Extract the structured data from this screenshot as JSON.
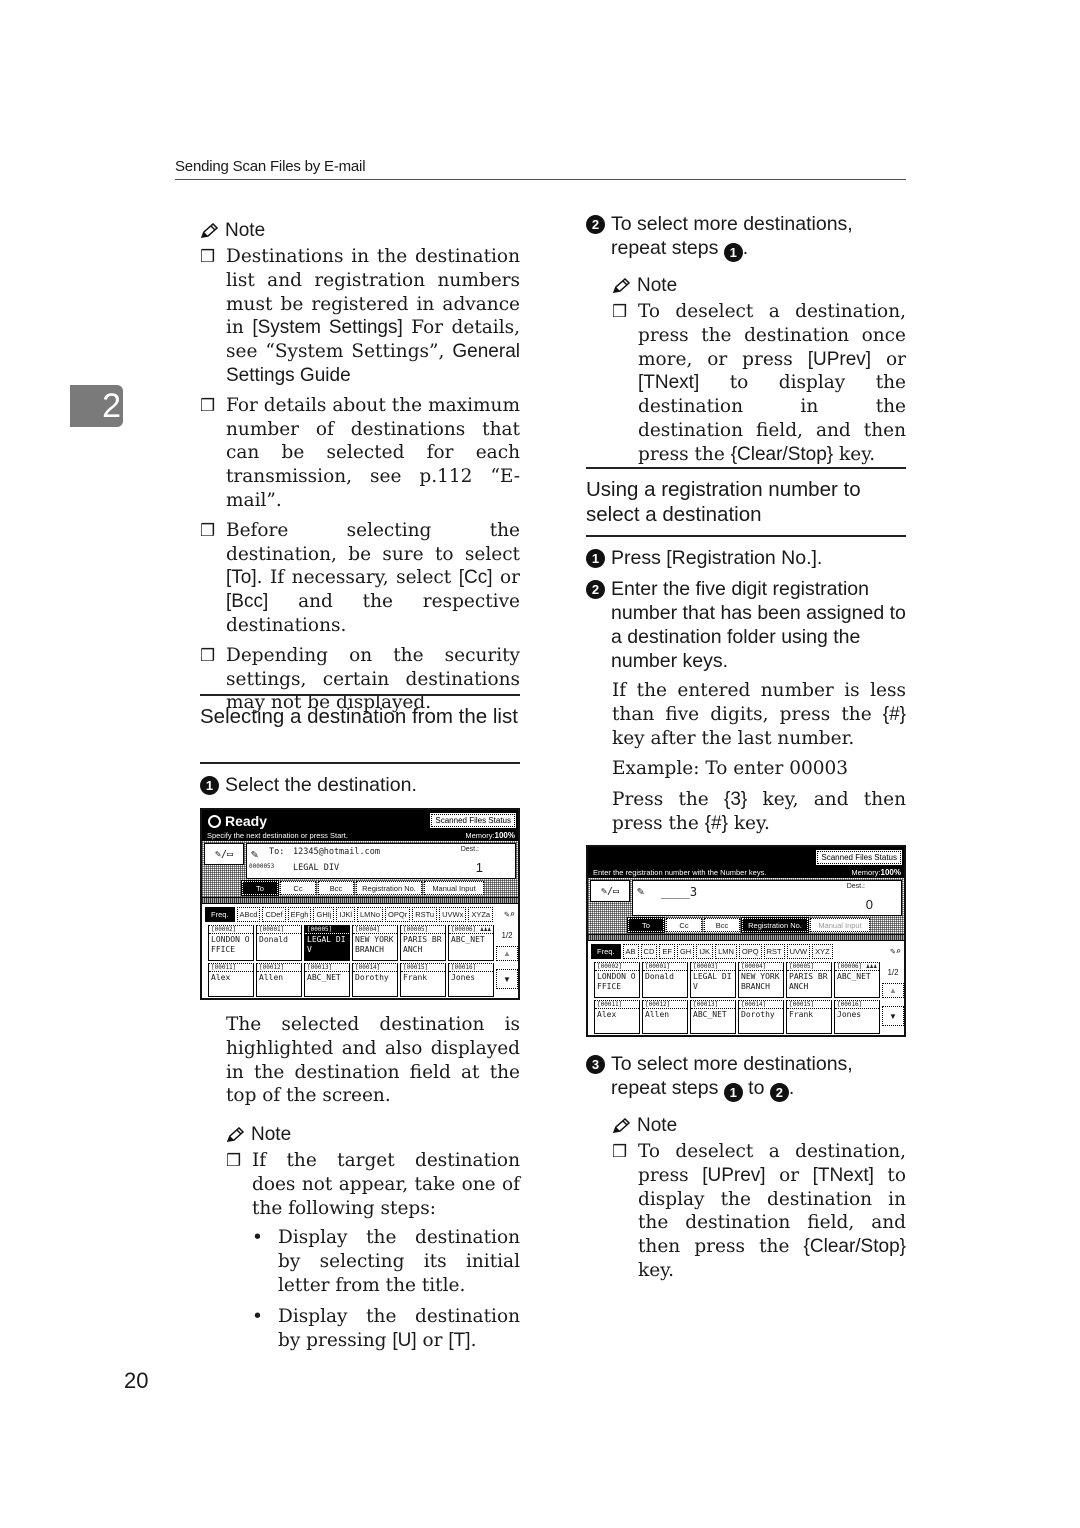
{
  "header": {
    "running_title": "Sending Scan Files by E-mail"
  },
  "chapter_tab": "2",
  "page_number": "20",
  "left_column": {
    "note1": {
      "heading": "Note",
      "items": [
        {
          "pre": "Destinations in the destination list and registration numbers must be registered in advance in ",
          "key": "[System Settings]",
          "post": " For details, see “System Settings”, ",
          "ref": "General Settings Guide"
        },
        {
          "text": "For details about the maximum number of destinations that can be selected for each transmission, see p.112 “E-mail”."
        },
        {
          "pre": "Before selecting the destination, be sure to select ",
          "key1": "[To]",
          "mid": ". If necessary, select ",
          "key2": "[Cc]",
          "mid2": " or ",
          "key3": "[Bcc]",
          "post": " and the respective destinations."
        },
        {
          "text": "Depending on the security settings, certain destinations may not be displayed."
        }
      ]
    },
    "section_title": "Selecting a destination from the list",
    "step1": {
      "num": "1",
      "text": "Select the destination."
    },
    "after_screen_text": "The selected destination is highlighted and also displayed in the destination field at the top of the screen.",
    "note2": {
      "heading": "Note",
      "item": "If the target destination does not appear, take one of the following steps:",
      "bullets": [
        {
          "text": "Display the destination by selecting its initial letter from the title."
        },
        {
          "pre": "Display the destination by pressing ",
          "key1": "[U]",
          "mid": " or ",
          "key2": "[T]",
          "post": "."
        }
      ]
    }
  },
  "right_column": {
    "step2": {
      "num": "2",
      "text": "To select more destinations, repeat steps",
      "ref": "1",
      "post": "."
    },
    "note3": {
      "heading": "Note",
      "item": {
        "pre": "To deselect a destination, press the destination once more, or press ",
        "key1": "[UPrev]",
        "mid": " or ",
        "key2": "[TNext]",
        "mid2": " to display the destination in the destination field, and then press the ",
        "key3": "{Clear/Stop}",
        "post": " key."
      }
    },
    "section_title": "Using a registration number to select a destination",
    "steps": [
      {
        "num": "1",
        "pre": "Press ",
        "key": "[Registration No.]",
        "post": "."
      },
      {
        "num": "2",
        "text": "Enter the five digit registration number that has been assigned to a destination folder using the number keys."
      }
    ],
    "para1": {
      "pre": "If the entered number is less than five digits, press the ",
      "key": "{#}",
      "post": " key after the last number."
    },
    "para2": "Example: To enter 00003",
    "para3": {
      "pre": "Press the ",
      "key1": "{3}",
      "mid": " key, and then press the ",
      "key2": "{#}",
      "post": " key."
    },
    "step3": {
      "num": "3",
      "text": "To select more destinations, repeat steps",
      "ref1": "1",
      "mid": "to",
      "ref2": "2",
      "post": "."
    },
    "note4": {
      "heading": "Note",
      "item": {
        "pre": "To deselect a destination, press ",
        "key1": "[UPrev]",
        "mid": " or ",
        "key2": "[TNext]",
        "mid2": " to display the destination in the destination field, and then press the ",
        "key3": "{Clear/Stop}",
        "post": " key."
      }
    }
  },
  "screen1": {
    "status": "Ready",
    "scanned_files_status": "Scanned Files Status",
    "message": "Specify the next destination or press Start.",
    "memory_label": "Memory:",
    "memory_value": "100%",
    "to_label": "To:",
    "to_value": "12345@hotmail.com",
    "reg_code": "0000053",
    "dest_name": "LEGAL DIV",
    "dest_label": "Dest.:",
    "dest_count": "1",
    "tabs": [
      "To",
      "Cc",
      "Bcc",
      "Registration No.",
      "Manual Input"
    ],
    "letters": [
      "Freq.",
      "ABcd",
      "CDef",
      "EFgh",
      "GHIj",
      "IJKl",
      "LMNo",
      "OPQr",
      "RSTu",
      "UVWx",
      "XYZa"
    ],
    "page": "1/2",
    "cells": [
      {
        "code": "[00002]",
        "name": "LONDON O FFICE"
      },
      {
        "code": "[00001]",
        "name": "Donald"
      },
      {
        "code": "[00005]",
        "name": "LEGAL DI V",
        "selected": true
      },
      {
        "code": "[00004]",
        "name": "NEW YORK BRANCH"
      },
      {
        "code": "[00005]",
        "name": "PARIS BR ANCH"
      },
      {
        "code": "[00006]",
        "name": "ABC_NET",
        "group": true
      },
      {
        "code": "[00011]",
        "name": "Alex"
      },
      {
        "code": "[00012]",
        "name": "Allen"
      },
      {
        "code": "[00013]",
        "name": "ABC_NET"
      },
      {
        "code": "[00014]",
        "name": "Dorothy"
      },
      {
        "code": "[00015]",
        "name": "Frank"
      },
      {
        "code": "[00016]",
        "name": "Jones"
      }
    ]
  },
  "screen2": {
    "scanned_files_status": "Scanned Files Status",
    "message": "Enter the registration number with the Number keys.",
    "memory_label": "Memory:",
    "memory_value": "100%",
    "entry_value": "____3",
    "dest_label": "Dest.:",
    "dest_count": "0",
    "tabs": [
      "To",
      "Cc",
      "Bcc",
      "Registration No.",
      "Manual Input"
    ],
    "letters": [
      "Freq.",
      "AB",
      "CD",
      "EF",
      "GH",
      "IJK",
      "LMN",
      "OPQ",
      "RST",
      "UVW",
      "XYZ"
    ],
    "page": "1/2",
    "cells": [
      {
        "code": "[00002]",
        "name": "LONDON O FFICE"
      },
      {
        "code": "[00001]",
        "name": "Donald"
      },
      {
        "code": "[00003]",
        "name": "LEGAL DI V"
      },
      {
        "code": "[00004]",
        "name": "NEW YORK BRANCH"
      },
      {
        "code": "[00005]",
        "name": "PARIS BR ANCH"
      },
      {
        "code": "[00006]",
        "name": "ABC_NET",
        "group": true
      },
      {
        "code": "[00011]",
        "name": "Alex"
      },
      {
        "code": "[00012]",
        "name": "Allen"
      },
      {
        "code": "[00013]",
        "name": "ABC_NET"
      },
      {
        "code": "[00014]",
        "name": "Dorothy"
      },
      {
        "code": "[00015]",
        "name": "Frank"
      },
      {
        "code": "[00016]",
        "name": "Jones"
      }
    ]
  }
}
